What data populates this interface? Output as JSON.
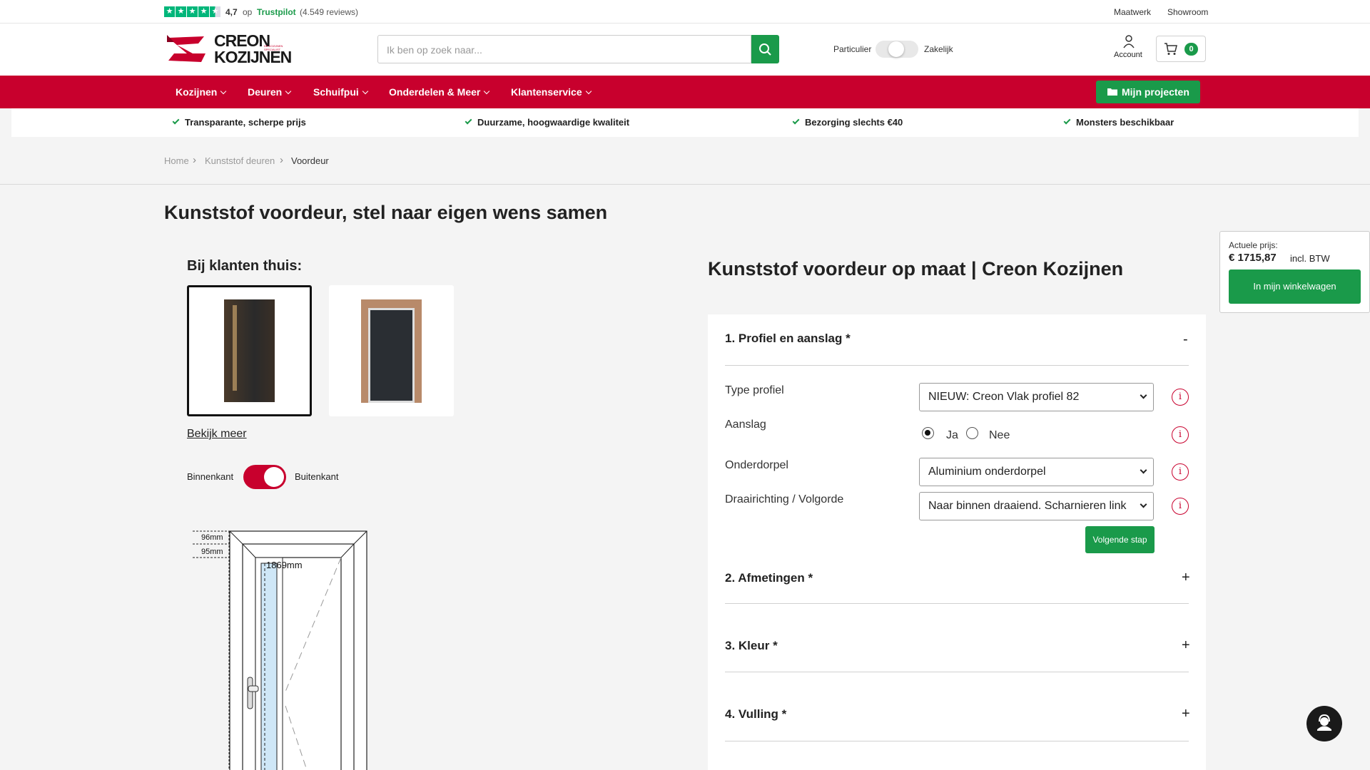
{
  "topbar": {
    "rating": "4,7",
    "op": "op",
    "trustpilot": "Trustpilot",
    "reviews": "(4.549 reviews)",
    "links": [
      "Maatwerk",
      "Showroom"
    ]
  },
  "header": {
    "logo_line1": "CREON",
    "logo_line2": "KOZIJNEN",
    "logo_tag": "DE KOZIJNEN SPECIALIST",
    "search_placeholder": "Ik ben op zoek naar...",
    "toggle_left": "Particulier",
    "toggle_right": "Zakelijk",
    "account": "Account",
    "cart_count": "0"
  },
  "nav": {
    "items": [
      "Kozijnen",
      "Deuren",
      "Schuifpui",
      "Onderdelen & Meer",
      "Klantenservice"
    ],
    "projects_button": "Mijn projecten"
  },
  "usp": [
    "Transparante, scherpe prijs",
    "Duurzame, hoogwaardige kwaliteit",
    "Bezorging slechts €40",
    "Monsters beschikbaar"
  ],
  "breadcrumb": [
    "Home",
    "Kunststof deuren",
    "Voordeur"
  ],
  "page_title": "Kunststof voordeur, stel naar eigen wens samen",
  "gallery": {
    "heading": "Bij klanten thuis:",
    "more_link": "Bekijk meer"
  },
  "view_toggle": {
    "left": "Binnenkant",
    "right": "Buitenkant"
  },
  "drawing": {
    "dim_top": "96mm",
    "dim_second": "95mm",
    "dim_height": "1869mm"
  },
  "product_title": "Kunststof voordeur op maat | Creon Kozijnen",
  "config": {
    "section1_title": "1. Profiel en aanslag *",
    "section1_toggle": "-",
    "fields": {
      "type_profiel_label": "Type profiel",
      "type_profiel_value": "NIEUW: Creon Vlak profiel 82",
      "aanslag_label": "Aanslag",
      "aanslag_ja": "Ja",
      "aanslag_nee": "Nee",
      "onderdorpel_label": "Onderdorpel",
      "onderdorpel_value": "Aluminium onderdorpel",
      "draairichting_label": "Draairichting / Volgorde",
      "draairichting_value": "Naar binnen draaiend. Scharnieren link"
    },
    "info_glyph": "i",
    "next_button": "Volgende stap",
    "collapsed_sections": [
      "2. Afmetingen *",
      "3. Kleur *",
      "4. Vulling *"
    ],
    "collapsed_toggle": "+"
  },
  "price_box": {
    "label": "Actuele prijs:",
    "price": "€ 1715,87",
    "vat": "incl. BTW",
    "cart_button": "In mijn winkelwagen"
  },
  "colors": {
    "brand_red": "#c8002d",
    "green": "#1a9a4a",
    "trustpilot_green": "#00b67a"
  }
}
